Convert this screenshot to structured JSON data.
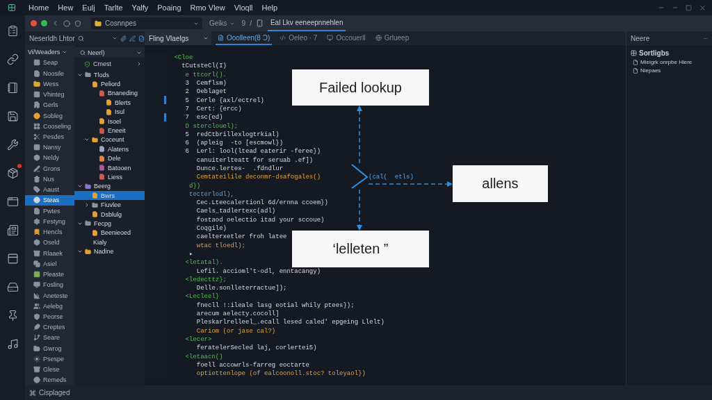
{
  "menubar": {
    "items": [
      "Home",
      "Hew",
      "Eulj",
      "Tarlte",
      "Yalfy",
      "Poaing",
      "Rmo Vlew",
      "Vloqll",
      "Help"
    ]
  },
  "activity_bar": {
    "items": [
      {
        "badge": false
      },
      {
        "badge": false
      },
      {
        "badge": false
      },
      {
        "badge": false
      },
      {
        "badge": false
      },
      {
        "badge": true
      },
      {
        "badge": false
      },
      {
        "badge": false
      },
      {
        "badge": false
      },
      {
        "badge": false
      },
      {
        "badge": false
      },
      {
        "badge": false
      }
    ]
  },
  "toolbar": {
    "address": "Cosnnpes",
    "dropdown": "Geiks",
    "count": "9",
    "separator": "/",
    "tabs": [
      {
        "label": "Eal Lkv eeneepnnehlen",
        "selected": true
      }
    ]
  },
  "panel_header": {
    "title": "Neserldh Lhtor",
    "filter": "Fling Vlaelgs"
  },
  "editor_tabs": [
    {
      "label": "Ooolleen(8 Ɔ)",
      "selected": true
    },
    {
      "label": "Oeleo · 7",
      "selected": false
    },
    {
      "label": "Occouerll",
      "selected": false
    },
    {
      "label": "Grlueep",
      "selected": false
    }
  ],
  "sidebar": {
    "header": "Vi/Weaders",
    "items": [
      {
        "label": "Seap",
        "selected": false,
        "color": "#8a93a3"
      },
      {
        "label": "Noosile",
        "selected": false,
        "color": "#8a93a3"
      },
      {
        "label": "Wess",
        "selected": false,
        "color": "#d6a935"
      },
      {
        "label": "Vhinteg",
        "selected": false,
        "color": "#8a93a3"
      },
      {
        "label": "Gerls",
        "selected": false,
        "color": "#8a93a3"
      },
      {
        "label": "Sobleg",
        "selected": false,
        "color": "#e8a030"
      },
      {
        "label": "Cooseling",
        "selected": false,
        "color": "#8a93a3"
      },
      {
        "label": "Pesdes",
        "selected": false,
        "color": "#8a93a3"
      },
      {
        "label": "Nansy",
        "selected": false,
        "color": "#8a93a3"
      },
      {
        "label": "Neldy",
        "selected": false,
        "color": "#8a93a3"
      },
      {
        "label": "Grons",
        "selected": false,
        "color": "#8a93a3"
      },
      {
        "label": "Nus",
        "selected": false,
        "color": "#8a93a3"
      },
      {
        "label": "Aaust",
        "selected": false,
        "color": "#8a93a3"
      },
      {
        "label": "Steas",
        "selected": true,
        "color": "#c9d3e0"
      },
      {
        "label": "Pwtes",
        "selected": false,
        "color": "#8a93a3"
      },
      {
        "label": "Festyng",
        "selected": false,
        "color": "#8a93a3"
      },
      {
        "label": "Hencls",
        "selected": false,
        "color": "#e0a030"
      },
      {
        "label": "Oseld",
        "selected": false,
        "color": "#8a93a3"
      },
      {
        "label": "Rlaaek",
        "selected": false,
        "color": "#8a93a3"
      },
      {
        "label": "Asiel",
        "selected": false,
        "color": "#8a93a3"
      },
      {
        "label": "Pleaste",
        "selected": false,
        "color": "#7fae55"
      },
      {
        "label": "Fosling",
        "selected": false,
        "color": "#8a93a3"
      },
      {
        "label": "Aneteste",
        "selected": false,
        "color": "#8a93a3"
      },
      {
        "label": "Aelebg",
        "selected": false,
        "color": "#8a93a3"
      },
      {
        "label": "Peorse",
        "selected": false,
        "color": "#8a93a3"
      },
      {
        "label": "Creptes",
        "selected": false,
        "color": "#8a93a3"
      },
      {
        "label": "Seare",
        "selected": false,
        "color": "#8a93a3"
      },
      {
        "label": "Gwrog",
        "selected": false,
        "color": "#8a93a3"
      },
      {
        "label": "Psespe",
        "selected": false,
        "color": "#8a93a3"
      },
      {
        "label": "Glese",
        "selected": false,
        "color": "#8a93a3"
      },
      {
        "label": "Remeds",
        "selected": false,
        "color": "#8a93a3"
      }
    ]
  },
  "tree": {
    "header": "Neerl)",
    "pinned": "Cmest",
    "items": [
      {
        "label": "Tlods",
        "kind": "folder",
        "expanded": true,
        "selected": false,
        "color": "#8a93a3",
        "children": [
          {
            "label": "Peliord",
            "kind": "leaf",
            "selected": false,
            "color": "#e8a030",
            "children": [
              {
                "label": "Bnaneding",
                "kind": "leaf",
                "selected": false,
                "color": "#d0584a",
                "children": [
                  {
                    "label": "Blerts",
                    "kind": "leaf",
                    "selected": false,
                    "color": "#e8a030"
                  },
                  {
                    "label": "Isul",
                    "kind": "leaf",
                    "selected": false,
                    "color": "#e8a030"
                  }
                ]
              },
              {
                "label": "Isoel",
                "kind": "leaf",
                "selected": false,
                "color": "#e8a030"
              },
              {
                "label": "Eneeit",
                "kind": "leaf",
                "selected": false,
                "color": "#d0584a"
              }
            ]
          },
          {
            "label": "Coceunt",
            "kind": "folder",
            "expanded": true,
            "selected": false,
            "color": "#e8a030",
            "children": [
              {
                "label": "Alatens",
                "kind": "leaf",
                "selected": false,
                "color": "#9aa6c4"
              },
              {
                "label": "Dele",
                "kind": "leaf",
                "selected": false,
                "color": "#e8803a"
              },
              {
                "label": "Batooen",
                "kind": "leaf",
                "selected": false,
                "color": "#b0559a"
              },
              {
                "label": "Liess",
                "kind": "leaf",
                "selected": false,
                "color": "#d0584a"
              }
            ]
          }
        ]
      },
      {
        "label": "Beerg",
        "kind": "folder",
        "expanded": true,
        "selected": false,
        "color": "#8a78d0",
        "children": [
          {
            "label": "Bwrs",
            "kind": "leaf",
            "selected": true,
            "color": "#e8a030"
          },
          {
            "label": "Fiuvlee",
            "kind": "folder",
            "expanded": false,
            "selected": false,
            "color": "#8a93a3"
          },
          {
            "label": "Dsblulg",
            "kind": "leaf",
            "selected": false,
            "color": "#e8a030"
          }
        ]
      },
      {
        "label": "Fecpg",
        "kind": "folder",
        "expanded": true,
        "selected": false,
        "color": "#8a93a3",
        "children": [
          {
            "label": "Beenieoed",
            "kind": "leaf",
            "selected": false,
            "color": "#e8a030"
          },
          {
            "label": "Kialy",
            "kind": "plain",
            "selected": false
          }
        ]
      },
      {
        "label": "Nadine",
        "kind": "folder",
        "expanded": true,
        "selected": false,
        "color": "#e8a030"
      }
    ]
  },
  "code": {
    "lines": [
      {
        "text": " <Cloe",
        "kind": "tag",
        "changed": false
      },
      {
        "text": "   tCutsteCl(I)",
        "kind": "plain",
        "changed": false
      },
      {
        "text": "    e ttcorl().",
        "kind": "tag",
        "changed": false
      },
      {
        "text": "    3  Cemflsm)",
        "kind": "plain",
        "changed": false
      },
      {
        "text": "    2  Oeblaget",
        "kind": "plain",
        "changed": false
      },
      {
        "text": "    5  Cerle {axl/ectrel)",
        "kind": "plain",
        "changed": true
      },
      {
        "text": "    7  Cert: {ercc)",
        "kind": "plain",
        "changed": false
      },
      {
        "text": "    7  esc{ed)",
        "kind": "plain",
        "changed": true
      },
      {
        "text": "    D sterclouel);",
        "kind": "tag",
        "changed": false
      },
      {
        "text": "    5  redCtbrillexlogtrkial)",
        "kind": "plain",
        "changed": false
      },
      {
        "text": "    6  (apleig  -to [escmowl})",
        "kind": "plain",
        "changed": false
      },
      {
        "text": "    6  Lerl: lool(ltead eaterir -feree})",
        "kind": "plain",
        "changed": false
      },
      {
        "text": "       canuiterlteatt for seruab .ef])",
        "kind": "plain",
        "changed": false
      },
      {
        "text": "       Dunce.lertes-  .fdndlur",
        "kind": "plain",
        "changed": false
      },
      {
        "text": "       Cemtateilile deconmr-dsafogales()",
        "kind": "key",
        "changed": false,
        "aside": {
          "text": "(cal(  etls)",
          "kind": "accent"
        }
      },
      {
        "text": "     d})",
        "kind": "tag",
        "changed": false
      },
      {
        "text": "     tecterlodl),",
        "kind": "accent",
        "changed": false
      },
      {
        "text": "       Cec.Lteecalertionl 6d/ernna ccoem})",
        "kind": "plain",
        "changed": false
      },
      {
        "text": "       Caels_tadlertexc(adl)",
        "kind": "plain",
        "changed": false
      },
      {
        "text": "       fostaod oelectio itad your sccoue)",
        "kind": "plain",
        "changed": false
      },
      {
        "text": "       Coqgile)",
        "kind": "plain",
        "changed": false
      },
      {
        "text": "       caelterxetler froh latee",
        "kind": "plain",
        "changed": false
      },
      {
        "text": "       wtac tloedl);",
        "kind": "key",
        "changed": false
      },
      {
        "text": "     ▸",
        "kind": "plain",
        "changed": false
      },
      {
        "text": "    <letatal).",
        "kind": "tag",
        "changed": false
      },
      {
        "text": "       Lefil. accioml't-odl, enntacangy)",
        "kind": "plain",
        "changed": false
      },
      {
        "text": "    <ledecttz};",
        "kind": "tag",
        "changed": false
      },
      {
        "text": "       Delle.sonlleterractue]);",
        "kind": "plain",
        "changed": false
      },
      {
        "text": "    <Lecleel}",
        "kind": "tag",
        "changed": false
      },
      {
        "text": "       fnecll !:ileale lasg eotial whily ptees});",
        "kind": "plain",
        "changed": false
      },
      {
        "text": "       arecum aelecty.cocoll]",
        "kind": "plain",
        "changed": false
      },
      {
        "text": "       Pleskarlrelleel_.ecall lesed caled' epgeing Llelt)",
        "kind": "plain",
        "changed": false
      },
      {
        "text": "       Cariom (or jase cal?)",
        "kind": "key",
        "changed": false
      },
      {
        "text": "    <lecer>",
        "kind": "tag",
        "changed": false
      },
      {
        "text": "       feratelerSecled laj, corlertei5)",
        "kind": "plain",
        "changed": false
      },
      {
        "text": "    <letaacn()",
        "kind": "tag",
        "changed": false
      },
      {
        "text": "       foell accowrls-farreg eoctarte",
        "kind": "plain",
        "changed": false
      },
      {
        "text": "       optiettenlope (of ealcoonoll.stoc? toleyaol})",
        "kind": "key",
        "changed": false
      }
    ]
  },
  "diagram": {
    "boxes": [
      "Failed lookup",
      "allens",
      "‘lelleten ”"
    ]
  },
  "right_panel": {
    "header": "Neere",
    "items": [
      {
        "label": "Sortligbs",
        "kind": "heading"
      },
      {
        "label": "Mleigrk onrpbe Hlere",
        "kind": "item"
      },
      {
        "label": "Niepaes",
        "kind": "item"
      }
    ]
  },
  "status_bar": {
    "text": "Cisplaged"
  }
}
